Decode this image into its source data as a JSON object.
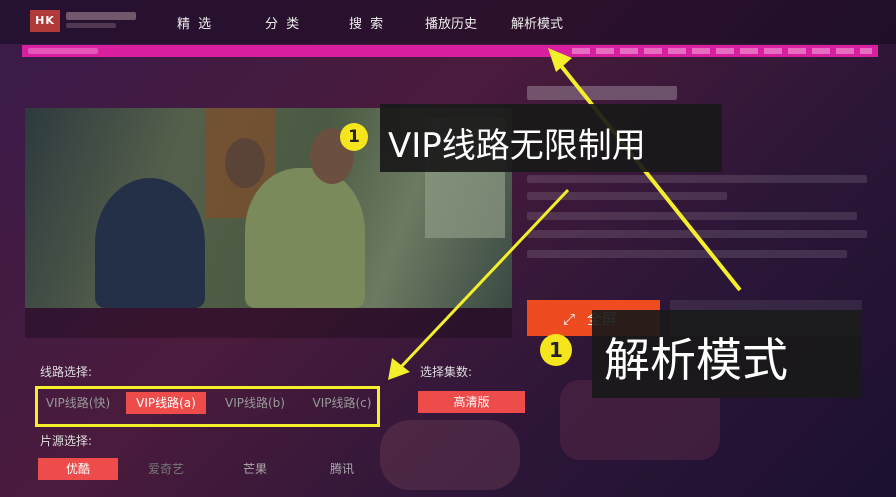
{
  "header": {
    "logo_text": "HK",
    "nav": [
      "精 选",
      "分 类",
      "搜 索",
      "播放历史",
      "解析模式"
    ]
  },
  "player": {
    "fullscreen_label": "全屏",
    "fullscreen_icon": "expand-icon"
  },
  "callouts": {
    "vip": {
      "badge": "1",
      "text": "VIP线路无限制用"
    },
    "parse": {
      "badge": "1",
      "text": "解析模式"
    }
  },
  "routes": {
    "label": "线路选择:",
    "items": [
      "VIP线路(快)",
      "VIP线路(a)",
      "VIP线路(b)",
      "VIP线路(c)"
    ],
    "active_index": 1
  },
  "episodes": {
    "label": "选择集数:",
    "items": [
      "高清版"
    ]
  },
  "sources": {
    "label": "片源选择:",
    "items": [
      "优酷",
      "爱奇艺",
      "芒果",
      "腾讯"
    ],
    "active_index": 0
  },
  "colors": {
    "accent": "#ee4b4b",
    "progress": "#d81fa0",
    "highlight": "#f3ef2b"
  }
}
